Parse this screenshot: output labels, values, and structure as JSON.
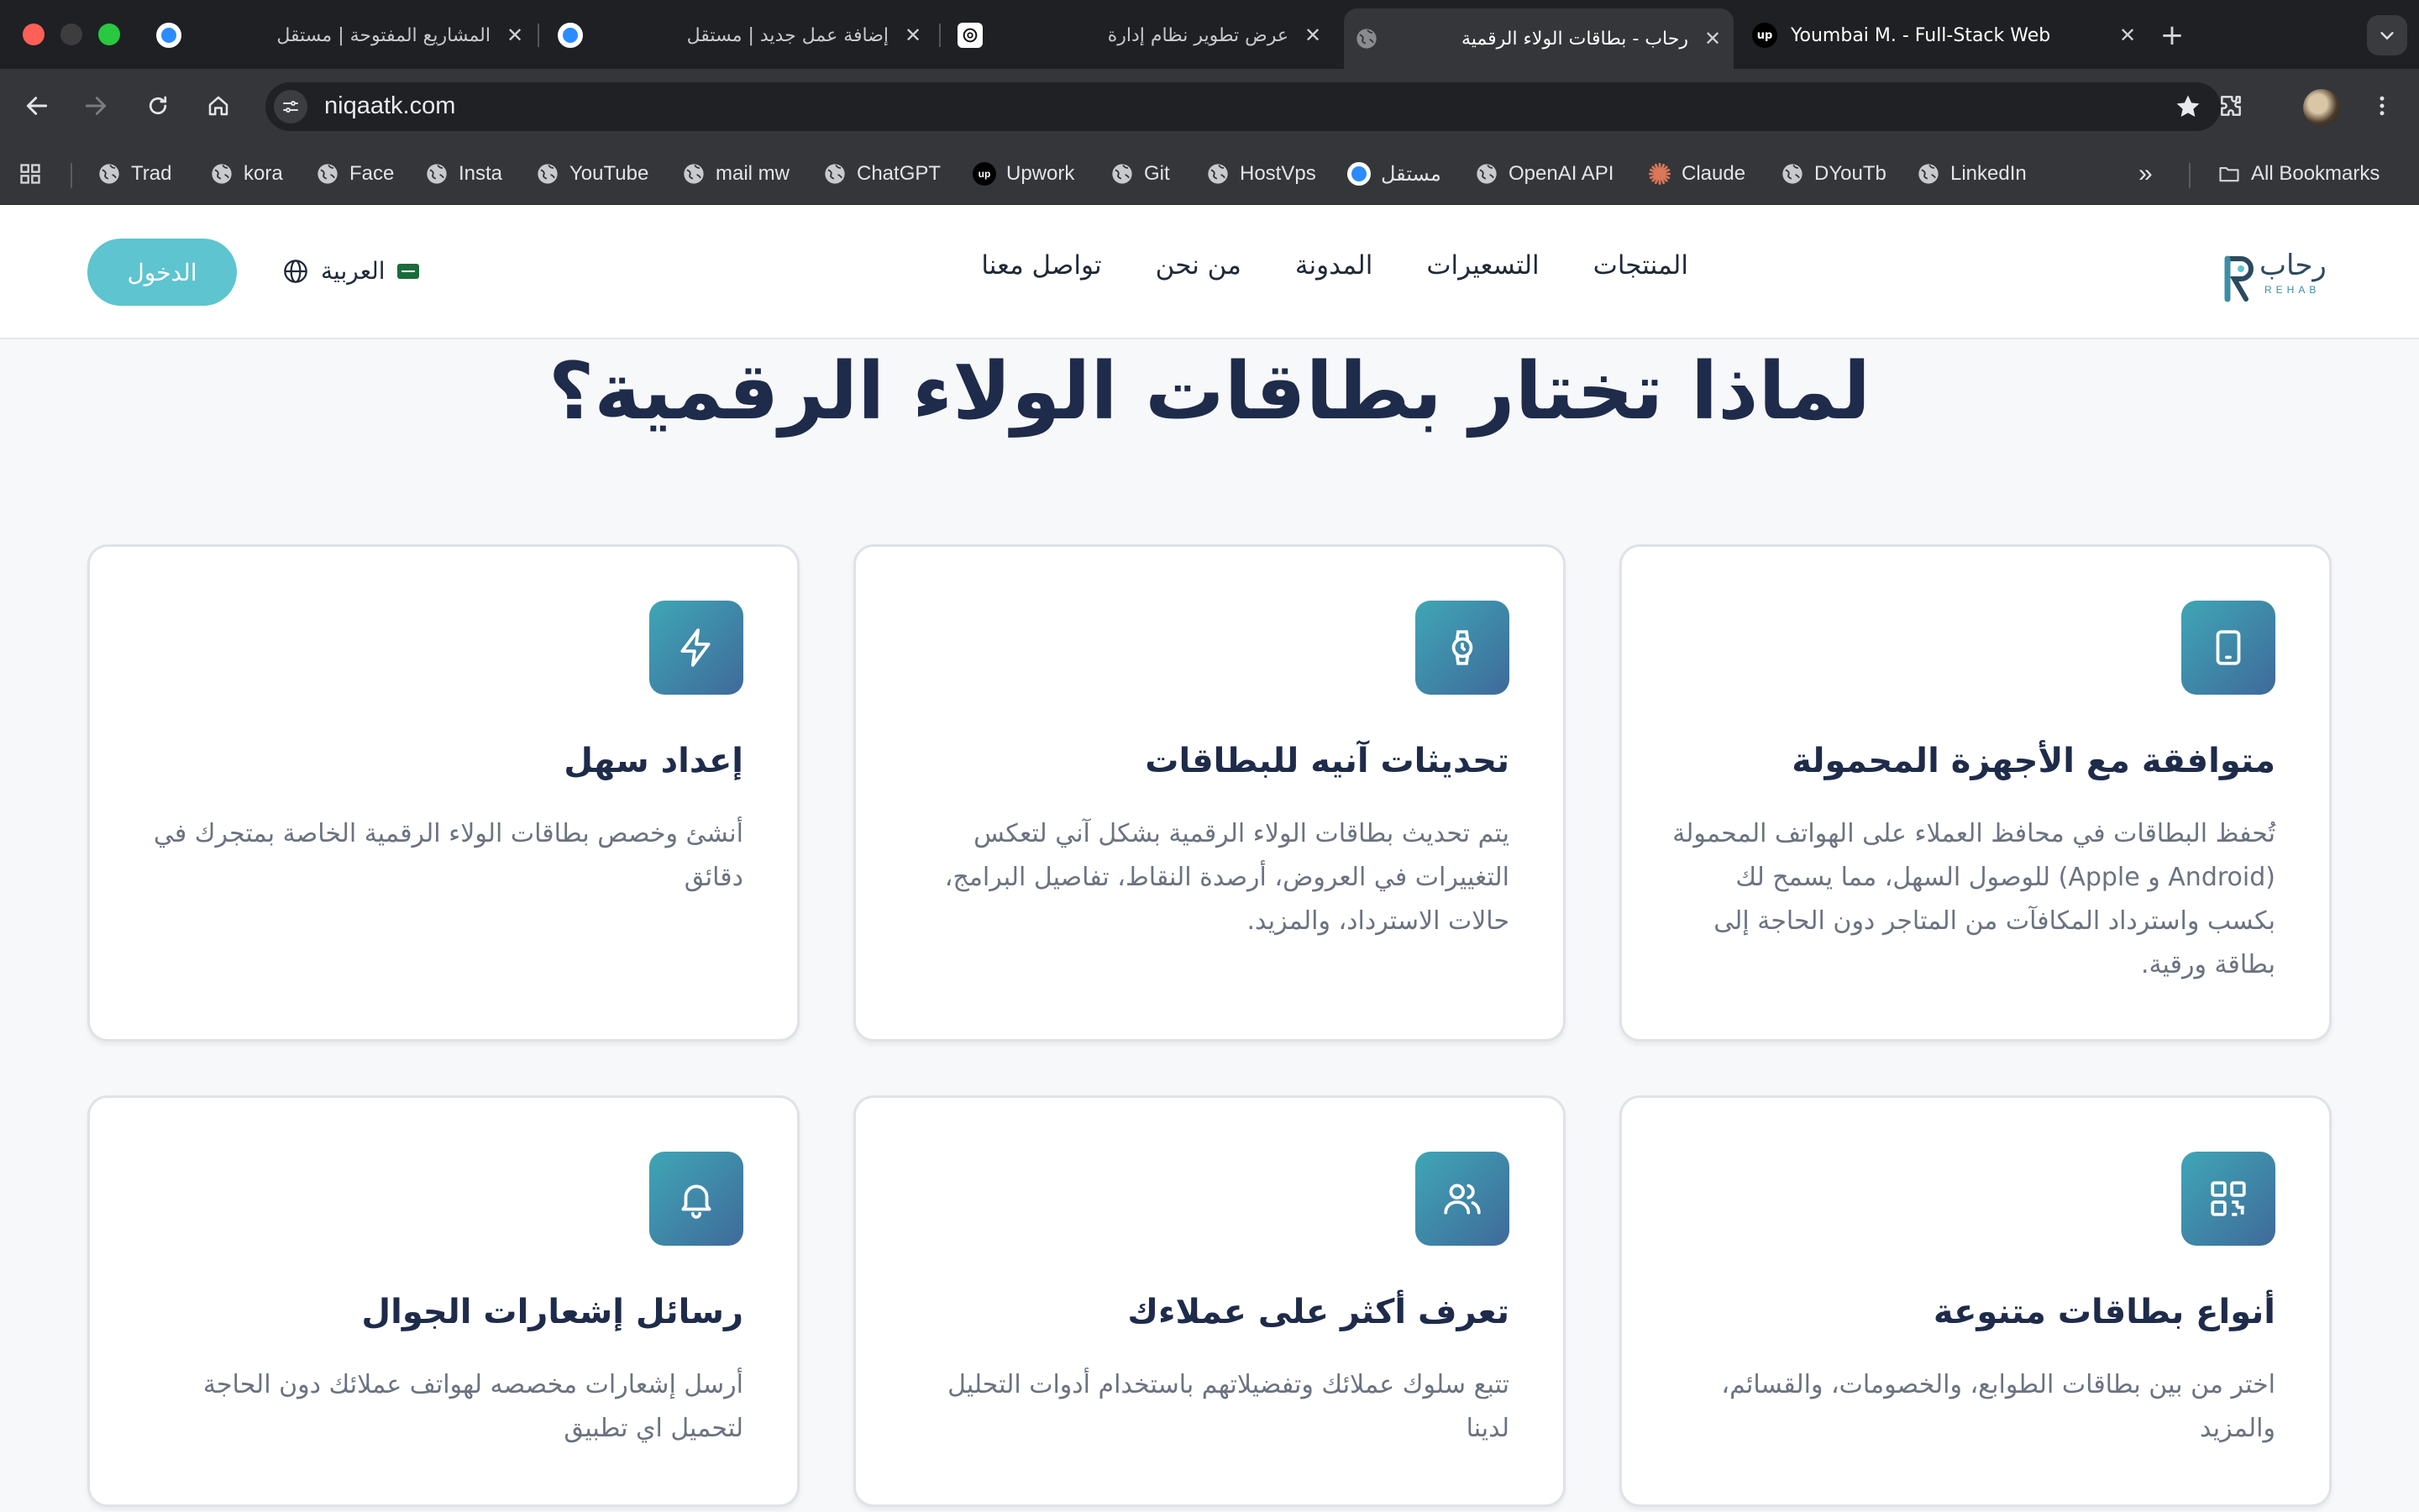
{
  "browser": {
    "tabs": [
      {
        "title": "المشاريع المفتوحة | مستقل",
        "favicon": "mostaql-icon"
      },
      {
        "title": "إضافة عمل جديد | مستقل",
        "favicon": "mostaql-icon"
      },
      {
        "title": "عرض تطوير نظام إدارة",
        "favicon": "chatgpt-icon"
      },
      {
        "title": "رحاب - بطاقات الولاء الرقمية",
        "favicon": "globe-icon",
        "active": true
      },
      {
        "title": "Youmbai M. - Full-Stack Web",
        "favicon": "upwork-icon"
      }
    ],
    "url": "niqaatk.com",
    "bookmarks": [
      "Trad",
      "kora",
      "Face",
      "Insta",
      "YouTube",
      "mail mw",
      "ChatGPT",
      "Upwork",
      "Git",
      "HostVps",
      "مستقل",
      "OpenAI API",
      "Claude",
      "DYouTb",
      "LinkedIn"
    ],
    "all_bookmarks": "All Bookmarks",
    "colors": {
      "chrome_dark": "#1f2023",
      "toolbar": "#35363a",
      "omnibox": "#202124"
    }
  },
  "site": {
    "logo_ar": "رحاب",
    "logo_en": "REHAB",
    "nav": [
      "المنتجات",
      "التسعيرات",
      "المدونة",
      "من نحن",
      "تواصل معنا"
    ],
    "language": "العربية",
    "login": "الدخول",
    "section_title": "لماذا تختار بطاقات الولاء الرقمية؟",
    "features": [
      {
        "icon": "tablet-icon",
        "title": "متوافقة مع الأجهزة المحمولة",
        "description": "تُحفظ البطاقات في محافظ العملاء على الهواتف المحمولة (Android و Apple) للوصول السهل، مما يسمح لك بكسب واسترداد المكافآت من المتاجر دون الحاجة إلى بطاقة ورقية."
      },
      {
        "icon": "watch-icon",
        "title": "تحديثات آنيه للبطاقات",
        "description": "يتم تحديث بطاقات الولاء الرقمية بشكل آني لتعكس التغييرات في العروض، أرصدة النقاط، تفاصيل البرامج، حالات الاسترداد، والمزيد."
      },
      {
        "icon": "lightning-icon",
        "title": "إعداد سهل",
        "description": "أنشئ وخصص بطاقات الولاء الرقمية الخاصة بمتجرك في دقائق"
      },
      {
        "icon": "qr-code-icon",
        "title": "أنواع بطاقات متنوعة",
        "description": "اختر من بين بطاقات الطوابع، والخصومات، والقسائم، والمزيد"
      },
      {
        "icon": "users-icon",
        "title": "تعرف أكثر على عملاءك",
        "description": "تتبع سلوك عملائك وتفضيلاتهم باستخدام أدوات التحليل لدينا"
      },
      {
        "icon": "bell-icon",
        "title": "رسائل إشعارات الجوال",
        "description": "أرسل إشعارات مخصصه لهواتف عملائك دون الحاجة لتحميل اي تطبيق"
      }
    ],
    "colors": {
      "accent": "#5ec4cf",
      "heading": "#1e2b4a",
      "icon_gradient_start": "#3fa6b6",
      "icon_gradient_end": "#3f6a9a"
    }
  }
}
